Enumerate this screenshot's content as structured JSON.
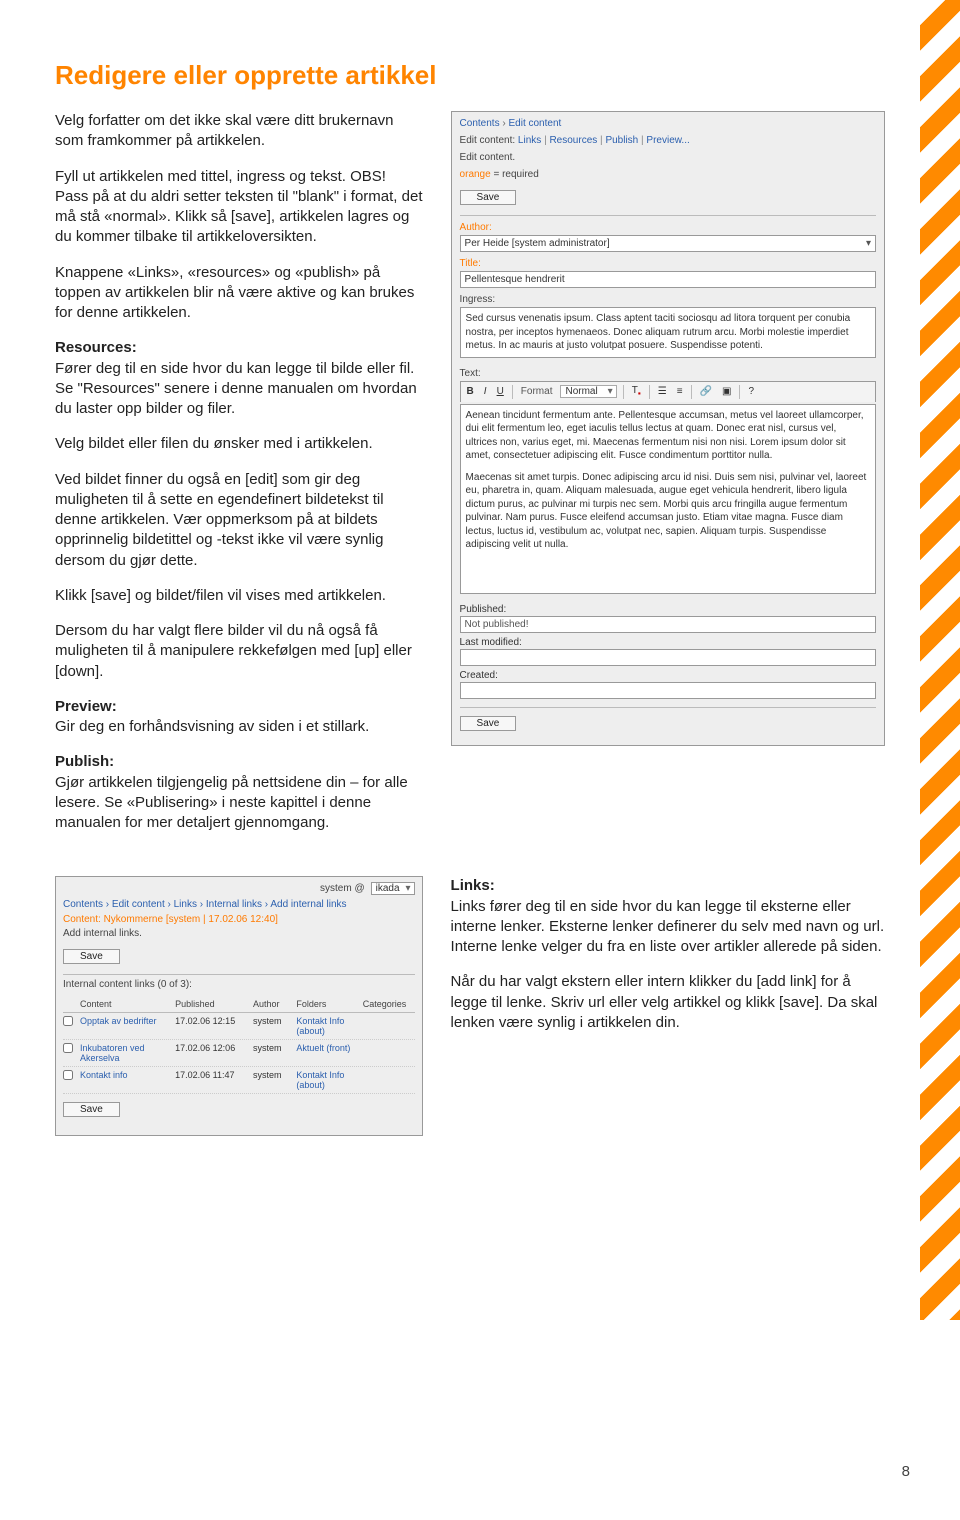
{
  "heading": "Redigere eller opprette artikkel",
  "page_number": "8",
  "left": {
    "p1": "Velg forfatter om det ikke skal være ditt brukernavn som framkommer på artikkelen.",
    "p2": "Fyll ut artikkelen med tittel, ingress og tekst. OBS! Pass på at du aldri setter teksten til \"blank\" i format, det må stå «normal». Klikk så [save], artikkelen lagres og du kommer tilbake til artikkeloversikten.",
    "p3": "Knappene «Links», «resources» og «publish» på toppen av artikkelen blir nå være aktive og kan brukes for denne artikkelen.",
    "resources_h": "Resources:",
    "p4": "Fører deg til en side hvor du kan legge til bilde eller fil. Se \"Resources\" senere i denne manualen om hvordan du laster opp bilder og filer.",
    "p5": "Velg bildet eller filen du ønsker med i artikkelen.",
    "p6a": "Ved bildet finner du også en [edit] som gir deg muligheten til å sette en egendefinert bildetekst til denne artikkelen. ",
    "p6b": "Vær oppmerksom på at bildets opprinnelig bildetittel og -tekst ikke vil være synlig dersom du gjør dette.",
    "p7": "Klikk [save] og bildet/filen vil vises med artikkelen.",
    "p8": "Dersom du har valgt flere bilder vil du nå også få muligheten til å manipulere rekkefølgen med [up] eller [down].",
    "preview_h": "Preview:",
    "preview_t": "Gir deg en forhåndsvisning av siden i et stillark.",
    "publish_h": "Publish:",
    "publish_t": "Gjør artikkelen tilgjengelig på nettsidene din – for alle lesere. Se «Publisering» i neste kapittel i denne manualen for mer detaljert gjennomgang."
  },
  "cms": {
    "bc": [
      "Contents",
      "Edit content"
    ],
    "tabs_prefix": "Edit content:",
    "tabs": [
      "Links",
      "Resources",
      "Publish",
      "Preview..."
    ],
    "subtitle": "Edit content.",
    "required_key": "orange",
    "required_val": " = required",
    "save": "Save",
    "author_label": "Author:",
    "author_value": "Per Heide [system administrator]",
    "title_label": "Title:",
    "title_value": "Pellentesque hendrerit",
    "ingress_label": "Ingress:",
    "ingress_value": "Sed cursus venenatis ipsum. Class aptent taciti sociosqu ad litora torquent per conubia nostra, per inceptos hymenaeos. Donec aliquam rutrum arcu. Morbi molestie imperdiet metus. In ac mauris at justo volutpat posuere. Suspendisse potenti.",
    "text_label": "Text:",
    "format_label": "Format",
    "format_value": "Normal",
    "text_p1": "Aenean tincidunt fermentum ante. Pellentesque accumsan, metus vel laoreet ullamcorper, dui elit fermentum leo, eget iaculis tellus lectus at quam. Donec erat nisl, cursus vel, ultrices non, varius eget, mi. Maecenas fermentum nisi non nisi. Lorem ipsum dolor sit amet, consectetuer adipiscing elit. Fusce condimentum porttitor nulla.",
    "text_p2": "Maecenas sit amet turpis. Donec adipiscing arcu id nisi. Duis sem nisi, pulvinar vel, laoreet eu, pharetra in, quam. Aliquam malesuada, augue eget vehicula hendrerit, libero ligula dictum purus, ac pulvinar mi turpis nec sem. Morbi quis arcu fringilla augue fermentum pulvinar. Nam purus. Fusce eleifend accumsan justo. Etiam vitae magna. Fusce diam lectus, luctus id, vestibulum ac, volutpat nec, sapien. Aliquam turpis. Suspendisse adipiscing velit ut nulla.",
    "published_label": "Published:",
    "published_value": "Not published!",
    "last_modified_label": "Last modified:",
    "created_label": "Created:"
  },
  "links_panel": {
    "who": "system @",
    "site": "ikada",
    "bc": [
      "Contents",
      "Edit content",
      "Links",
      "Internal links",
      "Add internal links"
    ],
    "content_line": "Content: Nykommerne [system | 17.02.06 12:40]",
    "add_line": "Add internal links.",
    "save": "Save",
    "count_line": "Internal content links (0 of 3):",
    "headers": [
      "",
      "Content",
      "Published",
      "Author",
      "Folders",
      "Categories"
    ],
    "rows": [
      {
        "content": "Opptak av bedrifter",
        "published": "17.02.06 12:15",
        "author": "system",
        "folders": "Kontakt Info (about)",
        "categories": ""
      },
      {
        "content": "Inkubatoren ved Akerselva",
        "published": "17.02.06 12:06",
        "author": "system",
        "folders": "Aktuelt (front)",
        "categories": ""
      },
      {
        "content": "Kontakt info",
        "published": "17.02.06 11:47",
        "author": "system",
        "folders": "Kontakt Info (about)",
        "categories": ""
      }
    ]
  },
  "right_text": {
    "links_h": "Links:",
    "links_p1": "Links fører deg til en side hvor du kan legge til eksterne eller interne lenker. Eksterne lenker definerer du selv med navn og url. Interne lenke velger du fra en liste over artikler allerede på siden.",
    "links_p2": "Når du har valgt ekstern eller intern klikker du [add link] for å legge til lenke. Skriv url eller velg artikkel og klikk [save]. Da skal lenken være synlig i artikkelen din."
  }
}
